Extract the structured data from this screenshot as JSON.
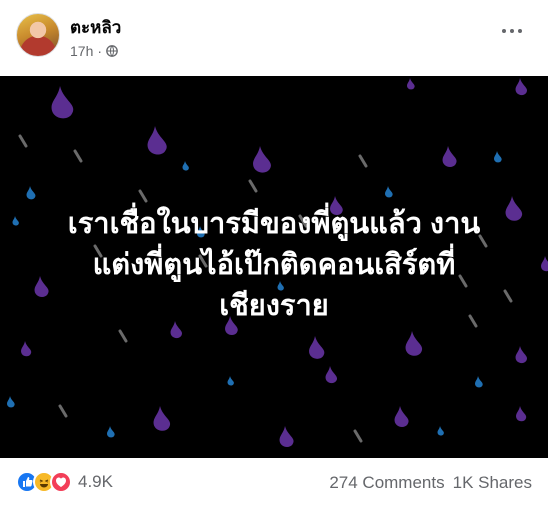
{
  "post": {
    "author": "ตะหลิว",
    "time": "17h",
    "separator": "·",
    "text_lines": [
      "เราเชื่อในบารมีของพี่ตูนแล้ว งาน",
      "แต่งพี่ตูนไอ้เป๊กติดคอนเสิร์ตที่",
      "เชียงราย"
    ],
    "background_color": "#000000",
    "drop_colors": [
      "#5b2e91",
      "#1f6fb2",
      "#6a6a6a"
    ]
  },
  "footer": {
    "reaction_count": "4.9K",
    "comments": "274 Comments",
    "shares": "1K Shares"
  },
  "icons": {
    "privacy": "globe-icon",
    "more": "more-options-icon",
    "reactions": [
      "like-icon",
      "haha-icon",
      "love-icon"
    ]
  }
}
